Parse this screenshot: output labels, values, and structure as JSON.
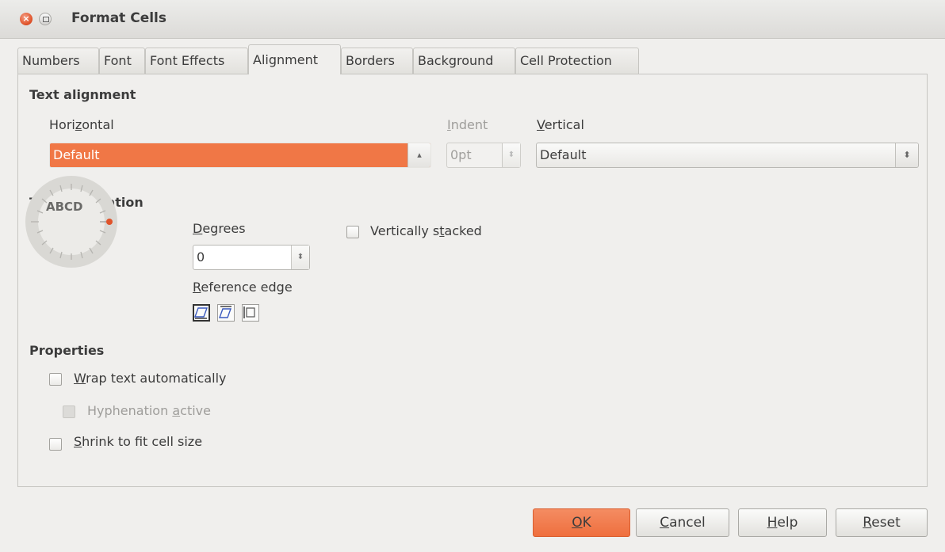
{
  "window": {
    "title": "Format Cells"
  },
  "tabs": [
    "Numbers",
    "Font",
    "Font Effects",
    "Alignment",
    "Borders",
    "Background",
    "Cell Protection"
  ],
  "active_tab": "Alignment",
  "text_alignment": {
    "heading": "Text alignment",
    "horizontal": {
      "label_pre": "Hori",
      "label_u": "z",
      "label_post": "ontal",
      "value": "Default"
    },
    "indent": {
      "label_pre": "",
      "label_u": "I",
      "label_post": "ndent",
      "value": "0pt"
    },
    "vertical": {
      "label_pre": "",
      "label_u": "V",
      "label_post": "ertical",
      "value": "Default"
    }
  },
  "text_orientation": {
    "heading": "Text orientation",
    "dial_text": "ABCD",
    "degrees": {
      "label_pre": "",
      "label_u": "D",
      "label_post": "egrees",
      "value": "0"
    },
    "reference_edge": {
      "label_pre": "",
      "label_u": "R",
      "label_post": "eference edge"
    },
    "vertically_stacked": {
      "label_pre": "Vertically s",
      "label_u": "t",
      "label_post": "acked"
    }
  },
  "properties": {
    "heading": "Properties",
    "wrap": {
      "label_pre": "",
      "label_u": "W",
      "label_post": "rap text automatically"
    },
    "hyphenation": {
      "label_pre": "Hyphenation ",
      "label_u": "a",
      "label_post": "ctive"
    },
    "shrink": {
      "label_pre": "",
      "label_u": "S",
      "label_post": "hrink to fit cell size"
    }
  },
  "buttons": {
    "ok": {
      "pre": "",
      "u": "O",
      "post": "K"
    },
    "cancel": {
      "pre": "",
      "u": "C",
      "post": "ancel"
    },
    "help": {
      "pre": "",
      "u": "H",
      "post": "elp"
    },
    "reset": {
      "pre": "",
      "u": "R",
      "post": "eset"
    }
  },
  "colors": {
    "accent": "#f07746",
    "background": "#f0efed"
  },
  "icons": [
    "close-icon",
    "maximize-icon",
    "spin-arrows-icon",
    "combo-arrows-icon",
    "reference-edge-bottom-icon",
    "reference-edge-top-icon",
    "reference-edge-inside-icon"
  ]
}
